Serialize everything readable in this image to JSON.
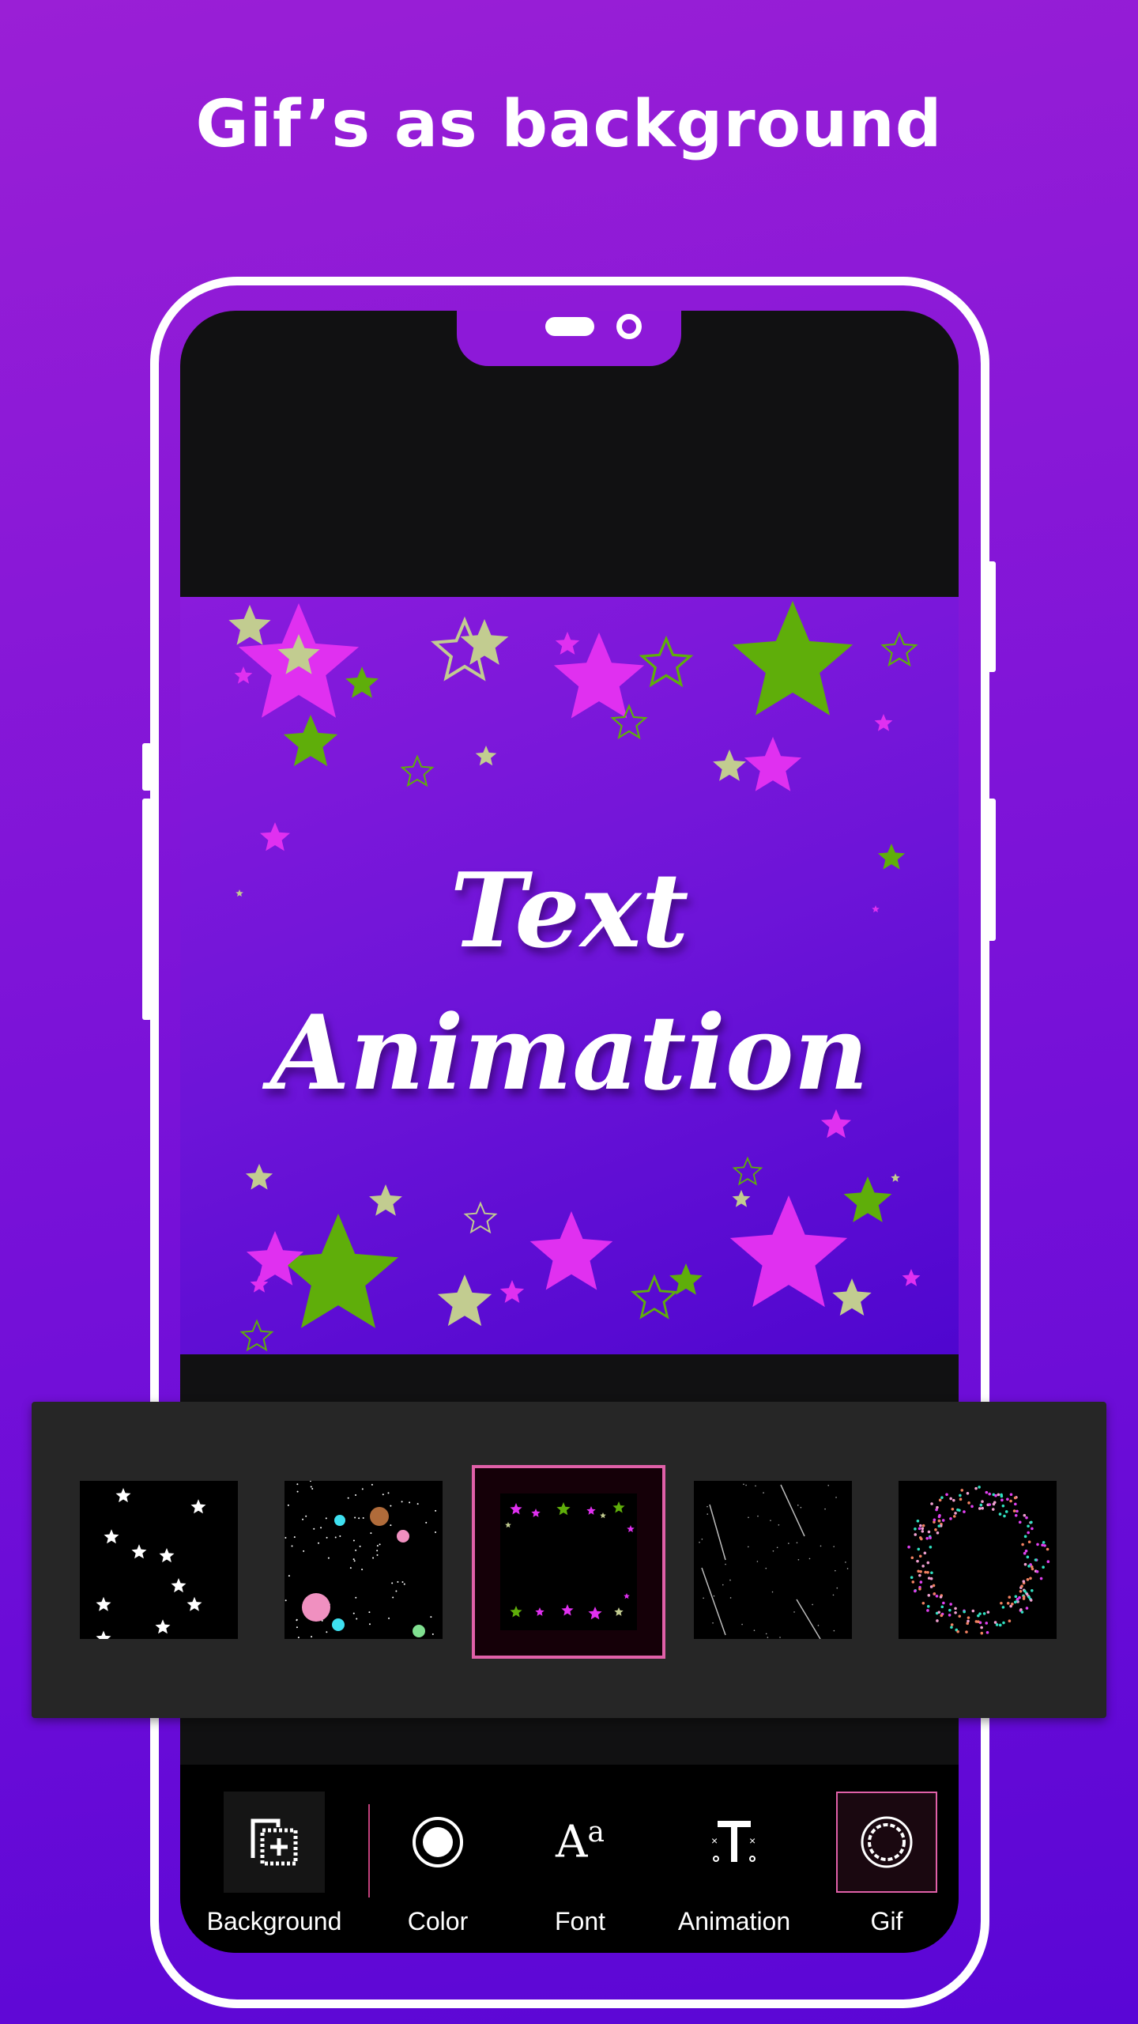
{
  "header": {
    "title": "Gif’s as background"
  },
  "preview": {
    "line1": "Text",
    "line2": "Animation"
  },
  "gif_strip": {
    "items": [
      {
        "name": "sparkles"
      },
      {
        "name": "planets"
      },
      {
        "name": "stars-frame",
        "selected": true
      },
      {
        "name": "shooting-stars"
      },
      {
        "name": "confetti-ring"
      }
    ]
  },
  "toolbar": {
    "items": [
      {
        "label": "Background",
        "icon": "add-layer-icon",
        "active": false
      },
      {
        "label": "Color",
        "icon": "color-circle-icon",
        "active": false
      },
      {
        "label": "Font",
        "icon": "font-aa-icon",
        "active": false
      },
      {
        "label": "Animation",
        "icon": "text-animation-icon",
        "active": false
      },
      {
        "label": "Gif",
        "icon": "gif-ring-icon",
        "active": true
      }
    ]
  },
  "colors": {
    "accent": "#e060a8",
    "background": "#7a12d8",
    "panel": "#262626"
  }
}
